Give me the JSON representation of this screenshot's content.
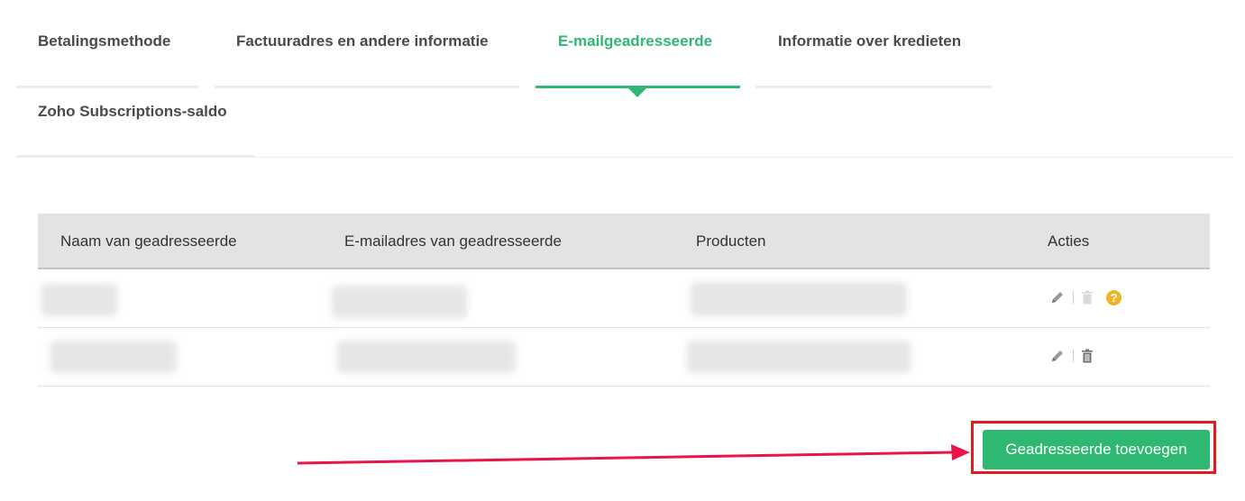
{
  "tabs": [
    {
      "label": "Betalingsmethode",
      "active": false
    },
    {
      "label": "Factuuradres en andere informatie",
      "active": false
    },
    {
      "label": "E-mailgeadresseerde",
      "active": true
    },
    {
      "label": "Informatie over kredieten",
      "active": false
    },
    {
      "label": "Zoho Subscriptions-saldo",
      "active": false
    }
  ],
  "table": {
    "headers": {
      "name": "Naam van geadresseerde",
      "email": "E-mailadres van geadresseerde",
      "products": "Producten",
      "actions": "Acties"
    },
    "rows": [
      {
        "name": "",
        "email": "",
        "products": "",
        "actions": [
          "edit-icon",
          "delete-icon-disabled",
          "help-icon"
        ]
      },
      {
        "name": "",
        "email": "",
        "products": "",
        "actions": [
          "edit-icon",
          "delete-icon"
        ]
      }
    ]
  },
  "add_button": {
    "label": "Geadresseerde toevoegen"
  },
  "colors": {
    "accent": "#2eb872",
    "highlight": "#e01c1c",
    "arrow": "#e8144a",
    "help": "#f0b429"
  }
}
